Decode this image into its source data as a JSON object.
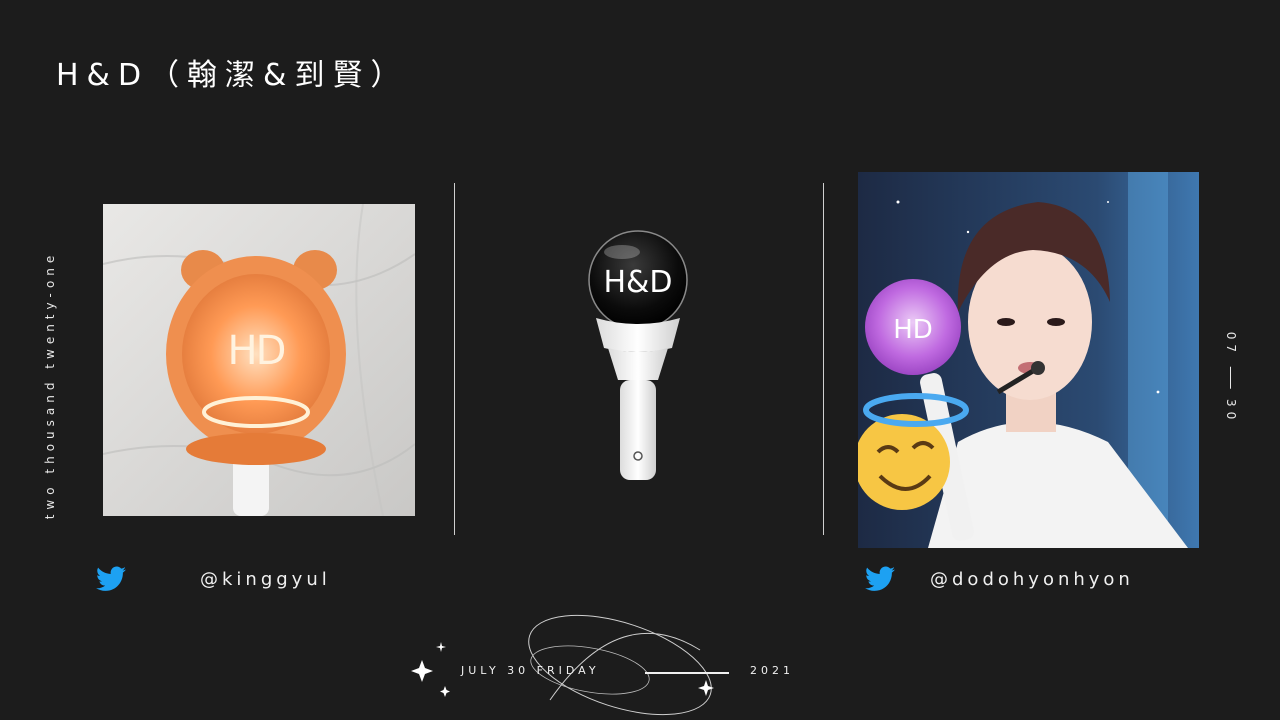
{
  "title": "H&D（翰潔&到賢）",
  "side_left_text": "two thousand twenty-one",
  "side_right": {
    "month": "07",
    "day": "30"
  },
  "photos": {
    "left": {
      "icon": "hd-lightstick-with-bear-cover-photo"
    },
    "center": {
      "icon": "hd-lightstick-product-image",
      "logo": "H&D"
    },
    "right": {
      "icon": "performer-holding-lightstick-photo",
      "sticker": "smiling-face-with-halo-emoji"
    }
  },
  "social": {
    "left_handle": "@kinggyul",
    "right_handle": "@dodohyonhyon",
    "icon": "twitter-bird-icon",
    "icon_color": "#1da1f2"
  },
  "footer": {
    "date_text": "JULY 30 FRIDAY",
    "year": "2021"
  },
  "colors": {
    "background": "#1c1c1c",
    "text": "#ffffff",
    "glow_orange": "#ff8a3d",
    "glow_pink": "#d86cf0"
  }
}
